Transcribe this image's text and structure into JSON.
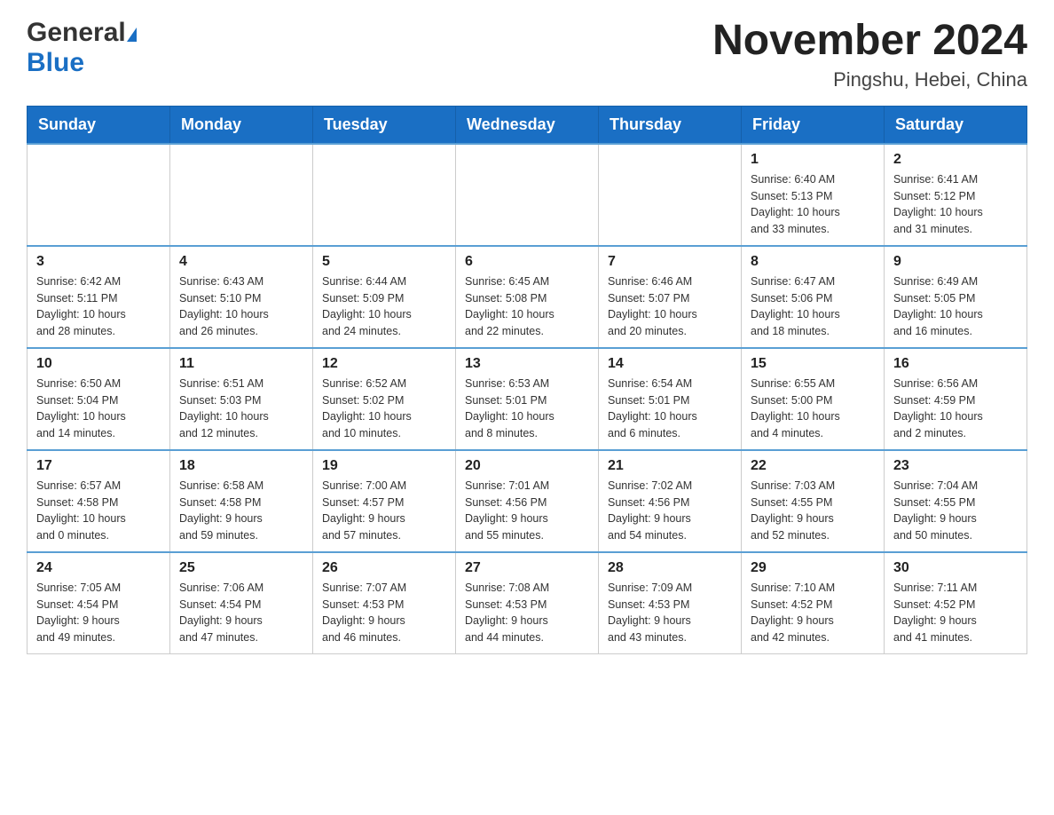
{
  "header": {
    "logo_general": "General",
    "logo_blue": "Blue",
    "month_title": "November 2024",
    "location": "Pingshu, Hebei, China"
  },
  "weekdays": [
    "Sunday",
    "Monday",
    "Tuesday",
    "Wednesday",
    "Thursday",
    "Friday",
    "Saturday"
  ],
  "weeks": [
    {
      "days": [
        {
          "number": "",
          "info": ""
        },
        {
          "number": "",
          "info": ""
        },
        {
          "number": "",
          "info": ""
        },
        {
          "number": "",
          "info": ""
        },
        {
          "number": "",
          "info": ""
        },
        {
          "number": "1",
          "info": "Sunrise: 6:40 AM\nSunset: 5:13 PM\nDaylight: 10 hours\nand 33 minutes."
        },
        {
          "number": "2",
          "info": "Sunrise: 6:41 AM\nSunset: 5:12 PM\nDaylight: 10 hours\nand 31 minutes."
        }
      ]
    },
    {
      "days": [
        {
          "number": "3",
          "info": "Sunrise: 6:42 AM\nSunset: 5:11 PM\nDaylight: 10 hours\nand 28 minutes."
        },
        {
          "number": "4",
          "info": "Sunrise: 6:43 AM\nSunset: 5:10 PM\nDaylight: 10 hours\nand 26 minutes."
        },
        {
          "number": "5",
          "info": "Sunrise: 6:44 AM\nSunset: 5:09 PM\nDaylight: 10 hours\nand 24 minutes."
        },
        {
          "number": "6",
          "info": "Sunrise: 6:45 AM\nSunset: 5:08 PM\nDaylight: 10 hours\nand 22 minutes."
        },
        {
          "number": "7",
          "info": "Sunrise: 6:46 AM\nSunset: 5:07 PM\nDaylight: 10 hours\nand 20 minutes."
        },
        {
          "number": "8",
          "info": "Sunrise: 6:47 AM\nSunset: 5:06 PM\nDaylight: 10 hours\nand 18 minutes."
        },
        {
          "number": "9",
          "info": "Sunrise: 6:49 AM\nSunset: 5:05 PM\nDaylight: 10 hours\nand 16 minutes."
        }
      ]
    },
    {
      "days": [
        {
          "number": "10",
          "info": "Sunrise: 6:50 AM\nSunset: 5:04 PM\nDaylight: 10 hours\nand 14 minutes."
        },
        {
          "number": "11",
          "info": "Sunrise: 6:51 AM\nSunset: 5:03 PM\nDaylight: 10 hours\nand 12 minutes."
        },
        {
          "number": "12",
          "info": "Sunrise: 6:52 AM\nSunset: 5:02 PM\nDaylight: 10 hours\nand 10 minutes."
        },
        {
          "number": "13",
          "info": "Sunrise: 6:53 AM\nSunset: 5:01 PM\nDaylight: 10 hours\nand 8 minutes."
        },
        {
          "number": "14",
          "info": "Sunrise: 6:54 AM\nSunset: 5:01 PM\nDaylight: 10 hours\nand 6 minutes."
        },
        {
          "number": "15",
          "info": "Sunrise: 6:55 AM\nSunset: 5:00 PM\nDaylight: 10 hours\nand 4 minutes."
        },
        {
          "number": "16",
          "info": "Sunrise: 6:56 AM\nSunset: 4:59 PM\nDaylight: 10 hours\nand 2 minutes."
        }
      ]
    },
    {
      "days": [
        {
          "number": "17",
          "info": "Sunrise: 6:57 AM\nSunset: 4:58 PM\nDaylight: 10 hours\nand 0 minutes."
        },
        {
          "number": "18",
          "info": "Sunrise: 6:58 AM\nSunset: 4:58 PM\nDaylight: 9 hours\nand 59 minutes."
        },
        {
          "number": "19",
          "info": "Sunrise: 7:00 AM\nSunset: 4:57 PM\nDaylight: 9 hours\nand 57 minutes."
        },
        {
          "number": "20",
          "info": "Sunrise: 7:01 AM\nSunset: 4:56 PM\nDaylight: 9 hours\nand 55 minutes."
        },
        {
          "number": "21",
          "info": "Sunrise: 7:02 AM\nSunset: 4:56 PM\nDaylight: 9 hours\nand 54 minutes."
        },
        {
          "number": "22",
          "info": "Sunrise: 7:03 AM\nSunset: 4:55 PM\nDaylight: 9 hours\nand 52 minutes."
        },
        {
          "number": "23",
          "info": "Sunrise: 7:04 AM\nSunset: 4:55 PM\nDaylight: 9 hours\nand 50 minutes."
        }
      ]
    },
    {
      "days": [
        {
          "number": "24",
          "info": "Sunrise: 7:05 AM\nSunset: 4:54 PM\nDaylight: 9 hours\nand 49 minutes."
        },
        {
          "number": "25",
          "info": "Sunrise: 7:06 AM\nSunset: 4:54 PM\nDaylight: 9 hours\nand 47 minutes."
        },
        {
          "number": "26",
          "info": "Sunrise: 7:07 AM\nSunset: 4:53 PM\nDaylight: 9 hours\nand 46 minutes."
        },
        {
          "number": "27",
          "info": "Sunrise: 7:08 AM\nSunset: 4:53 PM\nDaylight: 9 hours\nand 44 minutes."
        },
        {
          "number": "28",
          "info": "Sunrise: 7:09 AM\nSunset: 4:53 PM\nDaylight: 9 hours\nand 43 minutes."
        },
        {
          "number": "29",
          "info": "Sunrise: 7:10 AM\nSunset: 4:52 PM\nDaylight: 9 hours\nand 42 minutes."
        },
        {
          "number": "30",
          "info": "Sunrise: 7:11 AM\nSunset: 4:52 PM\nDaylight: 9 hours\nand 41 minutes."
        }
      ]
    }
  ]
}
